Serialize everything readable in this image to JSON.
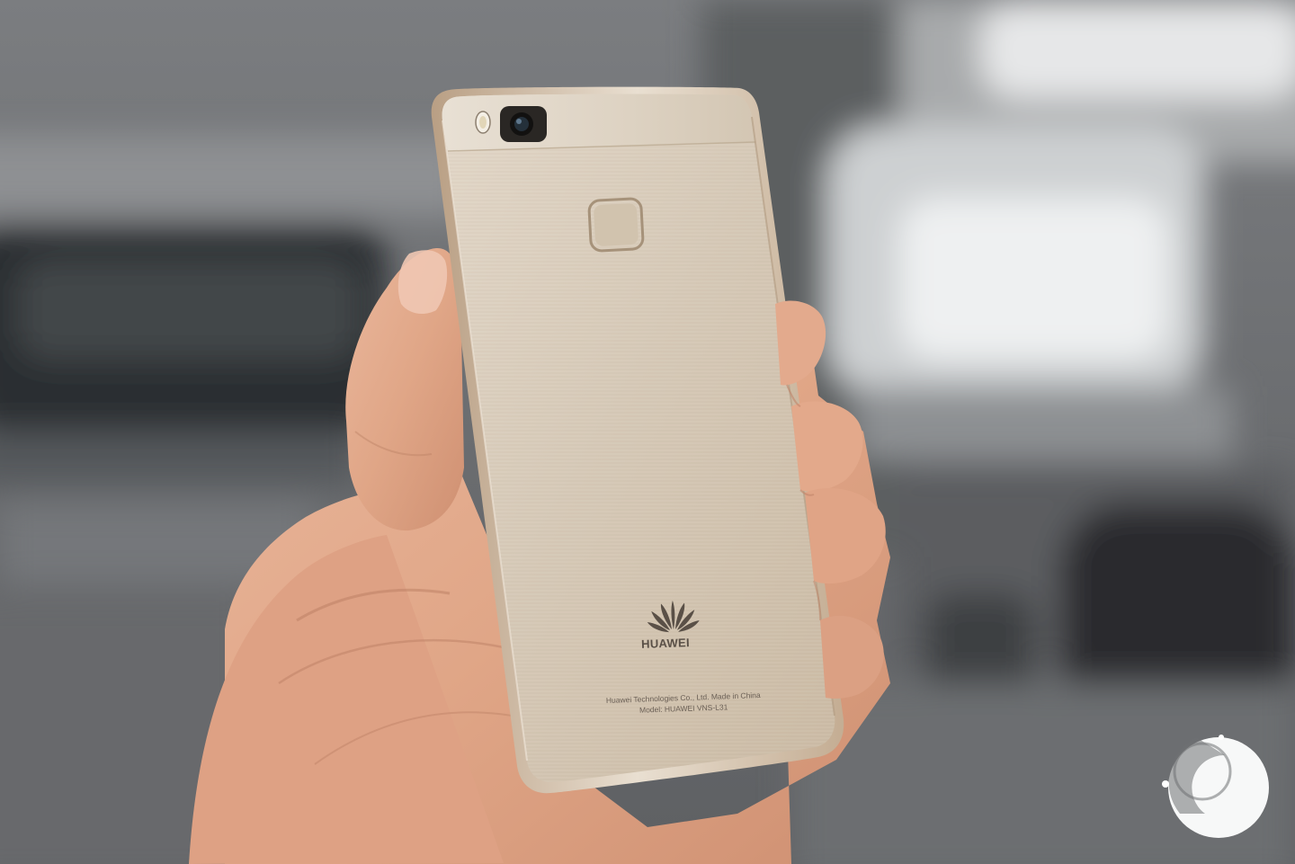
{
  "photo": {
    "subject": "hand holding smartphone",
    "device_text": {
      "brand": "HUAWEI",
      "legal_line_1": "Huawei Technologies Co., Ltd. Made in China",
      "legal_line_2": "Model: HUAWEI VNS-L31"
    },
    "watermark_icon": "frandroid-logo-icon",
    "colors": {
      "background": "#6f7173",
      "phone_body": "#d8ccbb",
      "phone_frame": "#c9b79f",
      "skin": "#e2aa8e",
      "watermark": "#ffffff"
    }
  }
}
